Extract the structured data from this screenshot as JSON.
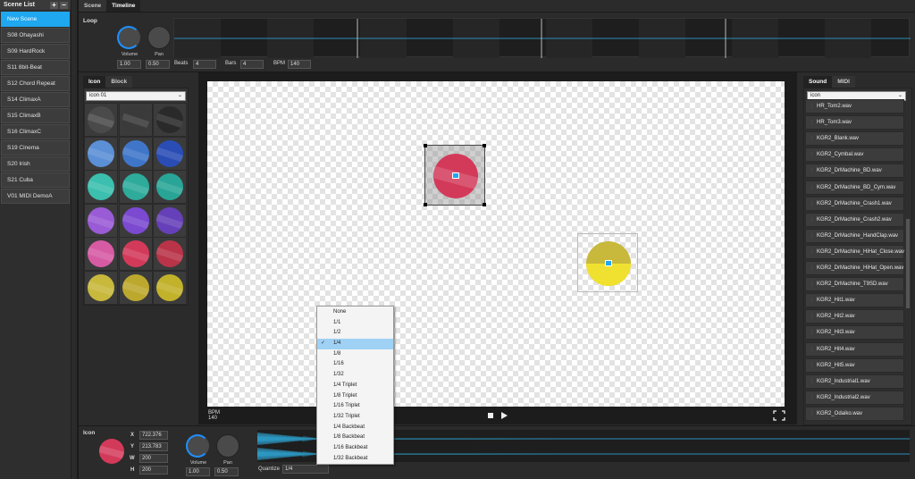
{
  "scene_list": {
    "title": "Scene List",
    "add": "+",
    "remove": "−",
    "items": [
      "New Scene",
      "S08 Ohayashi",
      "S09 HardRock",
      "S11 8bit-Beat",
      "S12 Chord Repeat",
      "S14 ClimaxA",
      "S15 ClimaxB",
      "S16 ClimaxC",
      "S19 Cinema",
      "S20 Irish",
      "S21 Cuba",
      "V01 MIDI DemoA"
    ]
  },
  "top_tabs": {
    "scene": "Scene",
    "timeline": "Timeline"
  },
  "loop": {
    "label": "Loop",
    "volume_label": "Volume",
    "pan_label": "Pan",
    "volume": "1.00",
    "pan": "0.50",
    "beats_label": "Beats",
    "beats": "4",
    "bars_label": "Bars",
    "bars": "4",
    "bpm_label": "BPM",
    "bpm": "140"
  },
  "left_tabs": {
    "icon": "Icon",
    "block": "Block"
  },
  "icon_select": "icon 01",
  "icon_colors": [
    [
      "#4a4a4a",
      "#3a3a3a",
      "#2a2a2a"
    ],
    [
      "#5b8fd6",
      "#3f76c9",
      "#2a4db5"
    ],
    [
      "#3bbfae",
      "#2eab9b",
      "#28a596"
    ],
    [
      "#9a5bd6",
      "#7b4ad1",
      "#6640b8"
    ],
    [
      "#d65ba3",
      "#d33a5a",
      "#b93448"
    ],
    [
      "#c8b83c",
      "#bda82e",
      "#c2b12a"
    ]
  ],
  "stage": {
    "bpm_label": "BPM",
    "bpm": "140"
  },
  "quantize_menu": {
    "options": [
      "None",
      "1/1",
      "1/2",
      "1/4",
      "1/8",
      "1/16",
      "1/32",
      "1/4  Triplet",
      "1/8  Triplet",
      "1/16 Triplet",
      "1/32 Triplet",
      "1/4  Backbeat",
      "1/8  Backbeat",
      "1/16 Backbeat",
      "1/32 Backbeat"
    ],
    "selected": "1/4"
  },
  "right_tabs": {
    "sound": "Sound",
    "midi": "MIDI"
  },
  "sound_select": "icon",
  "sounds": [
    "HR_Tom2.wav",
    "HR_Tom3.wav",
    "KGR2_Blank.wav",
    "KGR2_Cymbal.wav",
    "KGR2_DrMachine_BD.wav",
    "KGR2_DrMachine_BD_Cym.wav",
    "KGR2_DrMachine_Crash1.wav",
    "KGR2_DrMachine_Crash2.wav",
    "KGR2_DrMachine_HandClap.wav",
    "KGR2_DrMachine_HiHat_Close.wav",
    "KGR2_DrMachine_HiHat_Open.wav",
    "KGR2_DrMachine_T9SD.wav",
    "KGR2_Hit1.wav",
    "KGR2_Hit2.wav",
    "KGR2_Hit3.wav",
    "KGR2_Hit4.wav",
    "KGR2_Hit5.wav",
    "KGR2_Industrial1.wav",
    "KGR2_Industrial2.wav",
    "KGR2_Odaiko.wav"
  ],
  "inspector": {
    "label": "Icon",
    "x_label": "X",
    "x": "722.376",
    "y_label": "Y",
    "y": "213.783",
    "w_label": "W",
    "w": "200",
    "h_label": "H",
    "h": "200",
    "volume_label": "Volume",
    "volume": "1.00",
    "pan_label": "Pan",
    "pan": "0.50",
    "quantize_label": "Quantize",
    "quantize": "1/4"
  },
  "colors": {
    "accent": "#1fa7f0",
    "stage_bg": "#ffffff"
  }
}
